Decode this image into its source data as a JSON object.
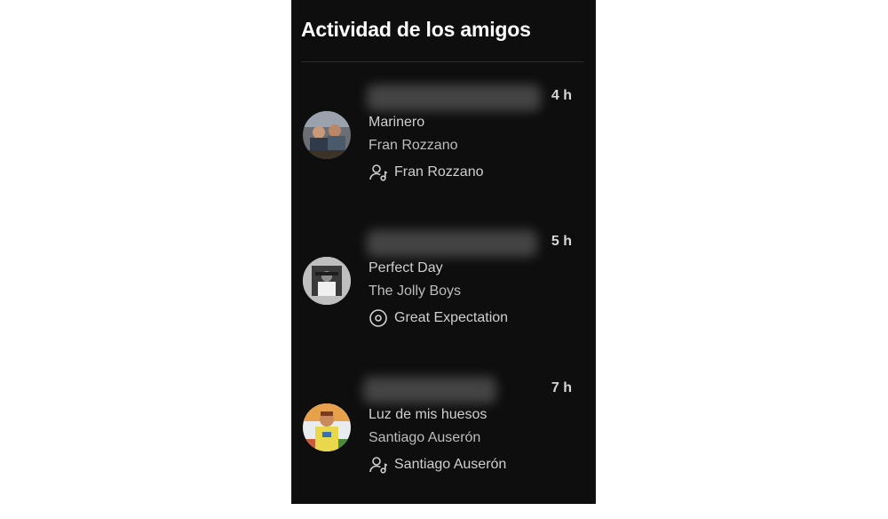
{
  "panel": {
    "title": "Actividad de los amigos"
  },
  "friends": [
    {
      "time": "4 h",
      "song": "Marinero",
      "artist": "Fran Rozzano",
      "context_icon": "user-icon",
      "context": "Fran Rozzano"
    },
    {
      "time": "5 h",
      "song": "Perfect Day",
      "artist": "The Jolly Boys",
      "context_icon": "album-icon",
      "context": "Great Expectation"
    },
    {
      "time": "7 h",
      "song": "Luz de mis huesos",
      "artist": "Santiago Auserón",
      "context_icon": "user-icon",
      "context": "Santiago Auserón"
    }
  ]
}
